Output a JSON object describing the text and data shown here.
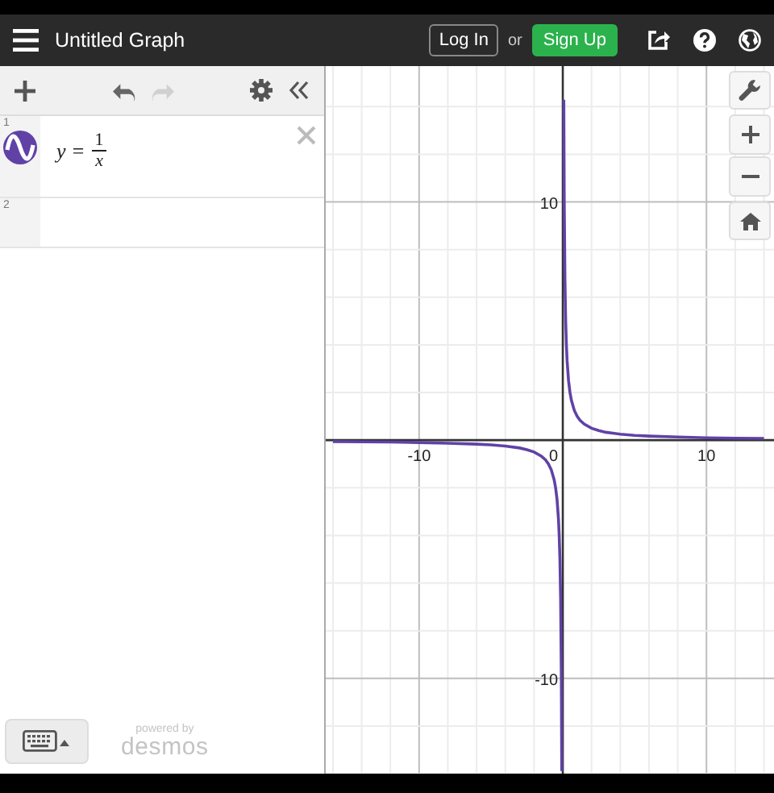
{
  "header": {
    "title": "Untitled Graph",
    "login": "Log In",
    "or": "or",
    "signup": "Sign Up"
  },
  "history": [
    {
      "kind": "undo",
      "disabled": false
    },
    {
      "kind": "redo",
      "disabled": true
    }
  ],
  "expressions": [
    {
      "number": "1",
      "lhs": "y =",
      "numerator": "1",
      "denominator": "x",
      "color": "#6042a6"
    },
    {
      "number": "2"
    }
  ],
  "footer": {
    "powered_by": "powered by",
    "brand": "desmos"
  },
  "graph": {
    "origin_label": "0",
    "chart_data": {
      "type": "line",
      "xlim": [
        -16.5,
        14.7
      ],
      "ylim": [
        -14,
        15.7
      ],
      "grid": true,
      "xticks": [
        -10,
        10
      ],
      "yticks": [
        -10,
        10
      ],
      "x": [
        -16,
        -14,
        -12,
        -10,
        -8,
        -6,
        -5,
        -4,
        -3,
        -2.5,
        -2,
        -1.5,
        -1.2,
        -1,
        -0.8,
        -0.6,
        -0.5,
        -0.4,
        -0.3,
        -0.25,
        -0.2,
        -0.15,
        -0.1,
        -0.072,
        0,
        0.07,
        0.1,
        0.15,
        0.2,
        0.25,
        0.3,
        0.4,
        0.5,
        0.6,
        0.8,
        1,
        1.2,
        1.5,
        2,
        2.5,
        3,
        4,
        5,
        6,
        8,
        10,
        12,
        14
      ],
      "series": [
        {
          "color": "#6042a6",
          "values": [
            -0.06,
            -0.07,
            -0.08,
            -0.1,
            -0.13,
            -0.17,
            -0.2,
            -0.25,
            -0.33,
            -0.4,
            -0.5,
            -0.67,
            -0.83,
            -1,
            -1.25,
            -1.67,
            -2,
            -2.5,
            -3.33,
            -4,
            -5,
            -6.67,
            -10,
            -13.89,
            null,
            14.29,
            10,
            6.67,
            5,
            4,
            3.33,
            2.5,
            2,
            1.67,
            1.25,
            1,
            0.83,
            0.67,
            0.5,
            0.4,
            0.33,
            0.25,
            0.2,
            0.17,
            0.13,
            0.1,
            0.08,
            0.07
          ]
        }
      ]
    }
  }
}
